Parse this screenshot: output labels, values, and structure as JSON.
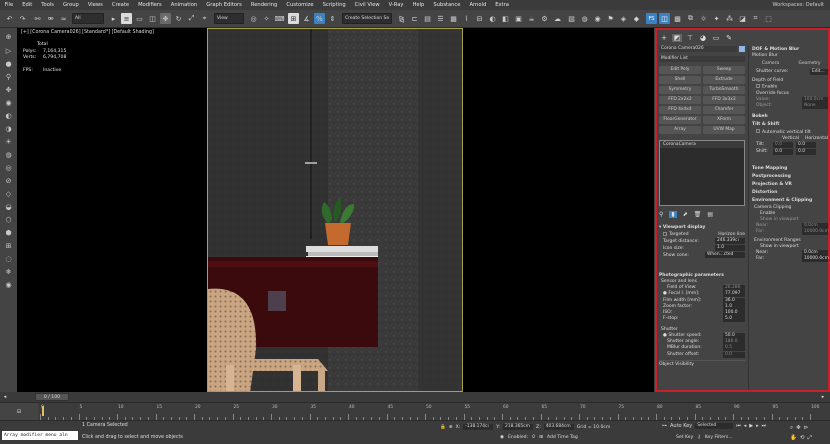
{
  "menu": {
    "items": [
      "File",
      "Edit",
      "Tools",
      "Group",
      "Views",
      "Create",
      "Modifiers",
      "Animation",
      "Graph Editors",
      "Rendering",
      "Customize",
      "Scripting",
      "Civil View",
      "V-Ray",
      "Help",
      "Substance",
      "Arnold",
      "Extra"
    ],
    "workspaces_label": "Workspaces: Default"
  },
  "toolbar": {
    "selection_filter": "All",
    "reference_coord": "View",
    "create_selection_set": "Create Selection Se"
  },
  "viewport": {
    "label": "[+] [Corona Camera026] [Standard*] [Default Shading]",
    "stats": {
      "total_label": "Total",
      "polys_label": "Polys:",
      "polys_value": "7,164,315",
      "verts_label": "Verts:",
      "verts_value": "6,794,708",
      "fps_label": "FPS:",
      "fps_value": "Inactive"
    }
  },
  "command_panel": {
    "object_name": "Corona Camera026",
    "modifier_list": "Modifier List",
    "modifier_buttons": [
      "Edit Poly",
      "Sweep",
      "Shell",
      "Extrude",
      "Symmetry",
      "TurboSmooth",
      "FFD 2x2x2",
      "FFD 3x3x3",
      "FFD 4x4x4",
      "Chamfer",
      "FloorGenerator",
      "XForm",
      "Array",
      "UVW Map"
    ],
    "stack_item": "CoronaCamera",
    "viewport_display": {
      "title": "Viewport display",
      "targeted": "Targeted",
      "horizon_line": "Horizon line",
      "target_distance_label": "Target distance:",
      "target_distance_value": "246.339cı",
      "icon_size_label": "Icon size:",
      "icon_size_value": "1.0",
      "show_cone_label": "Show cone:",
      "show_cone_value": "When...cted"
    },
    "photographic": {
      "title": "Photographic parameters",
      "sensor_lens": "Sensor and lens",
      "field_of_view_label": "Field of View:",
      "field_of_view_value": "26.286",
      "focal_label": "Focal l. [mm]:",
      "focal_value": "77.097",
      "film_width_label": "Film width [mm]:",
      "film_width_value": "36.0",
      "zoom_label": "Zoom factor:",
      "zoom_value": "1.0",
      "iso_label": "ISO:",
      "iso_value": "100.0",
      "fstop_label": "F-stop:",
      "fstop_value": "5.0",
      "shutter_label": "Shutter",
      "shutter_speed_label": "Shutter speed:",
      "shutter_speed_value": "50.0",
      "shutter_angle_label": "Shutter angle:",
      "shutter_angle_value": "180.0",
      "mblur_label": "MBlur duration:",
      "mblur_value": "0.5",
      "shutter_offset_label": "Shutter offset:",
      "shutter_offset_value": "0.0",
      "object_visibility": "Object Visibility"
    },
    "right_col": {
      "dof_title": "DOF & Motion Blur",
      "motion_blur": "Motion Blur",
      "camera_btn": "Camera",
      "geometry_btn": "Geometry",
      "shutter_curve_label": "Shutter curve:",
      "shutter_curve_value": "Edit...",
      "depth_of_field": "Depth of Field",
      "enable": "Enable",
      "override_focus": "Override focus",
      "value_label": "Value:",
      "value_value": "100.0cm",
      "object_label": "Object:",
      "object_value": "None",
      "bokeh": "Bokeh",
      "tilt_shift": "Tilt & Shift",
      "auto_vertical": "Automatic vertical tilt",
      "vertical": "Vertical",
      "horizontal": "Horizontal",
      "tilt_label": "Tilt:",
      "tilt_v": "0.0",
      "tilt_h": "0.0",
      "shift_label": "Shift:",
      "shift_v": "0.0",
      "shift_h": "0.0",
      "tone_mapping": "Tone Mapping",
      "postprocessing": "Postprocessing",
      "projection": "Projection & VR",
      "distortion": "Distortion",
      "env_clipping": "Environment & Clipping",
      "camera_clipping": "Camera Clipping",
      "enable2": "Enable",
      "show_in_viewport": "Show in viewport",
      "near_label": "Near:",
      "near_value": "0.0cm",
      "far_label": "Far:",
      "far_value": "10000.0cm",
      "env_ranges": "Environment Ranges",
      "show_in_viewport2": "Show in viewport",
      "near2_value": "0.0cm",
      "far2_value": "10000.0cm"
    }
  },
  "timeline": {
    "frame_display": "0 / 100",
    "ticks": [
      "0",
      "5",
      "10",
      "15",
      "20",
      "25",
      "30",
      "35",
      "40",
      "45",
      "50",
      "55",
      "60",
      "65",
      "70",
      "75",
      "80",
      "85",
      "90",
      "95",
      "100"
    ]
  },
  "status": {
    "script_listener": "Array modifier menu aln",
    "selection_info": "1 Camera Selected",
    "prompt": "Click and drag to select and move objects",
    "x_label": "X:",
    "x_value": "-138.174cı",
    "y_label": "Y:",
    "y_value": "218.365cm",
    "z_label": "Z:",
    "z_value": "403.684cm",
    "grid": "Grid = 10.0cm",
    "enabled_label": "Enabled:",
    "enabled_value": "0",
    "add_time_tag": "Add Time Tag",
    "auto_key": "Auto Key",
    "auto_key_value": "Selected",
    "set_key": "Set Key",
    "key_filters": "Key Filters..."
  },
  "colors": {
    "highlight_border": "#c8202a",
    "viewport_border": "#a7a14c",
    "accent_blue": "#4aa3df"
  }
}
